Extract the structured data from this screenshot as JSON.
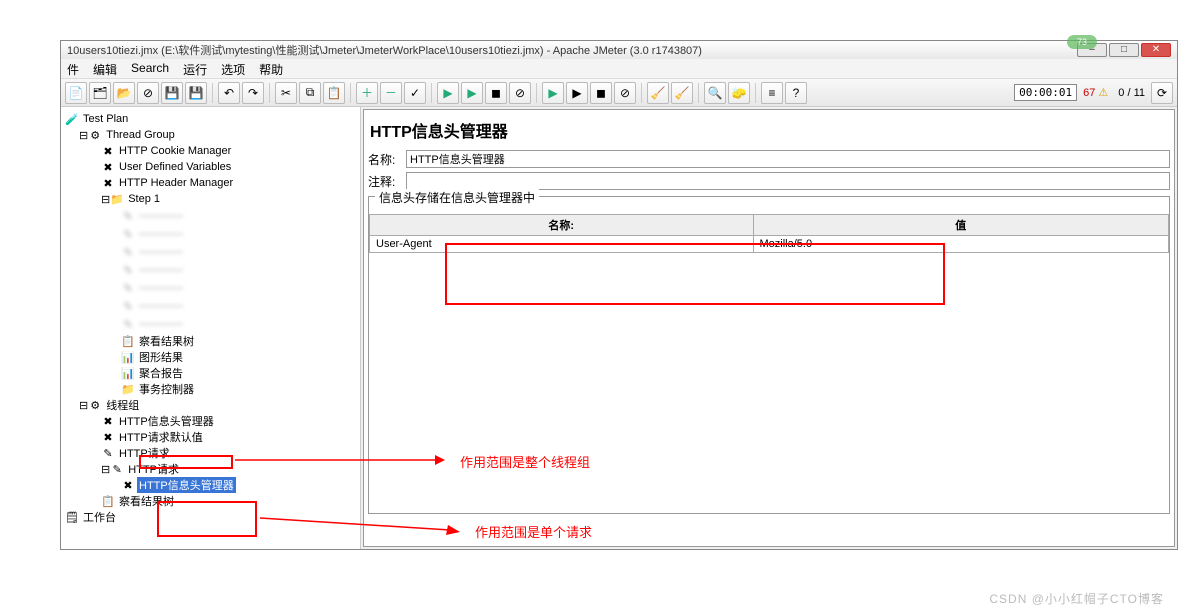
{
  "title": "10users10tiezi.jmx (E:\\软件测试\\mytesting\\性能测试\\Jmeter\\JmeterWorkPlace\\10users10tiezi.jmx) - Apache JMeter (3.0 r1743807)",
  "badge": "73",
  "menu": {
    "file": "件",
    "edit": "编辑",
    "search": "Search",
    "run": "运行",
    "options": "选项",
    "help": "帮助"
  },
  "toolbar": {
    "timer": "00:00:01",
    "errcount": "67",
    "runcount": "0 / 11"
  },
  "tree": {
    "root": "Test Plan",
    "tg1": "Thread Group",
    "cookie": "HTTP Cookie Manager",
    "udv": "User Defined Variables",
    "header": "HTTP Header Manager",
    "step1": "Step 1",
    "vrt": "察看结果树",
    "graph": "图形结果",
    "agg": "聚合报告",
    "tc": "事务控制器",
    "tg2": "线程组",
    "hhm": "HTTP信息头管理器",
    "hrd": "HTTP请求默认值",
    "req1": "HTTP请求",
    "req2": "HTTP请求",
    "hhm2": "HTTP信息头管理器",
    "vrt2": "察看结果树",
    "wb": "工作台"
  },
  "panel": {
    "title": "HTTP信息头管理器",
    "name_label": "名称:",
    "name_value": "HTTP信息头管理器",
    "comment_label": "注释:",
    "fieldset": "信息头存储在信息头管理器中",
    "col1": "名称:",
    "col2": "值",
    "row_name": "User-Agent",
    "row_value": "Mozilla/5.0"
  },
  "notes": {
    "n1": "作用范围是整个线程组",
    "n2": "作用范围是单个请求"
  },
  "watermark": "CSDN @小小红帽子CTO博客"
}
